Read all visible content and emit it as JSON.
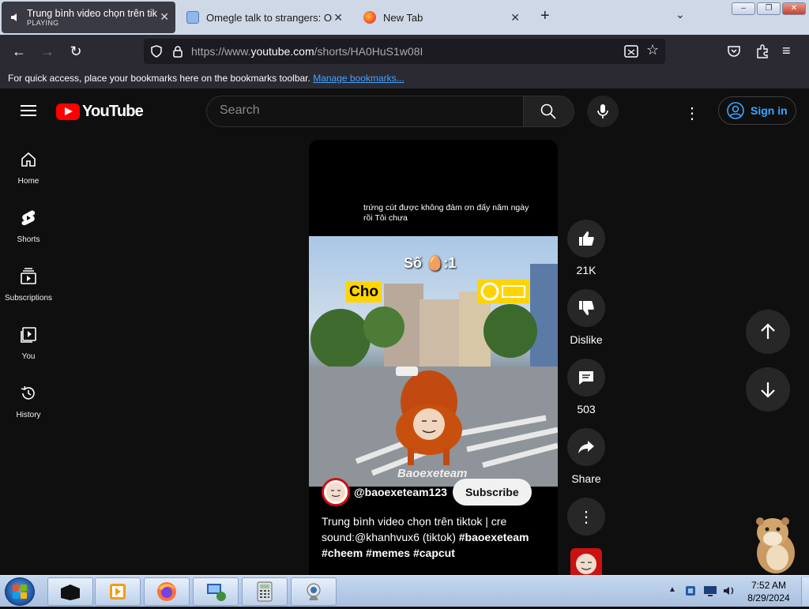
{
  "browser": {
    "tabs": [
      {
        "title": "Trung bình video chọn trên tiktok",
        "subtitle": "PLAYING",
        "active": true
      },
      {
        "title": "Omegle talk to strangers: Omeg",
        "active": false
      },
      {
        "title": "New Tab",
        "active": false
      }
    ],
    "url_prefix": "https://www.",
    "url_domain": "youtube.com",
    "url_path": "/shorts/HA0HuS1w08I",
    "bookmarks_text": "For quick access, place your bookmarks here on the bookmarks toolbar.",
    "bookmarks_link": "Manage bookmarks..."
  },
  "youtube": {
    "logo_text": "YouTube",
    "search_placeholder": "Search",
    "sign_in": "Sign in",
    "sidebar": [
      {
        "label": "Home",
        "icon": "home-icon"
      },
      {
        "label": "Shorts",
        "icon": "shorts-icon"
      },
      {
        "label": "Subscriptions",
        "icon": "subscriptions-icon"
      },
      {
        "label": "You",
        "icon": "you-icon"
      },
      {
        "label": "History",
        "icon": "history-icon"
      }
    ],
    "short": {
      "overlay_caption": "trứng cút được không đảm ơn đấy năm ngày rồi Tôi chưa",
      "scene_text": "Số 🥚:1",
      "sign_text": "Cho",
      "watermark": "Baoexeteam",
      "channel": "@baoexeteam123",
      "subscribe": "Subscribe",
      "description_plain": "Trung bình video chọn trên tiktok | cre sound:@khanhvux6 (tiktok)",
      "hashtags": "#baoexeteam #cheem #memes #capcut"
    },
    "actions": {
      "likes": "21K",
      "dislike": "Dislike",
      "comments": "503",
      "share": "Share"
    }
  },
  "taskbar": {
    "time": "7:52 AM",
    "date": "8/29/2024"
  },
  "colors": {
    "yt_red": "#ff0000",
    "yt_bg": "#0f0f0f",
    "signin_blue": "#3ea6ff",
    "firefox_toolbar": "#2b2a33"
  }
}
